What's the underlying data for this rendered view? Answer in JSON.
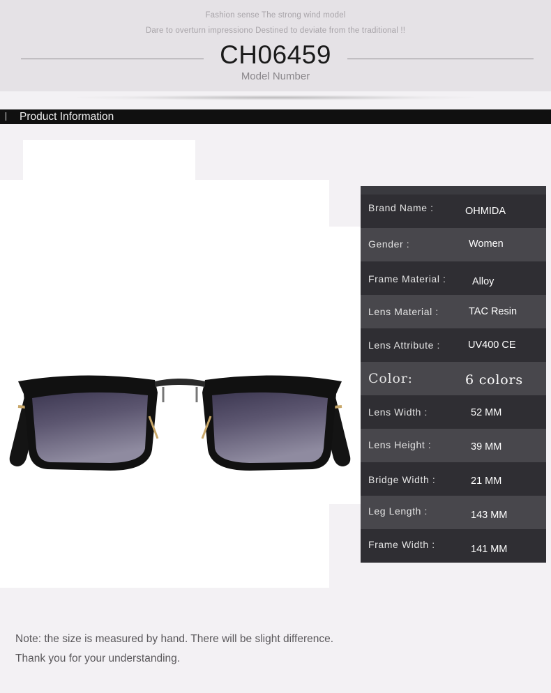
{
  "header": {
    "tagline_1": "Fashion sense The strong wind model",
    "tagline_2": "Dare to overturn impressiono Destined to deviate from the traditional !!",
    "model_number": "CH06459",
    "model_label": "Model Number"
  },
  "section": {
    "title": "Product Information"
  },
  "product_image": {
    "icon": "sunglasses-image",
    "lens_color": "#4b4560",
    "frame_color": "#111111"
  },
  "specs": [
    {
      "label": "Brand Name :",
      "value": "OHMIDA"
    },
    {
      "label": "Gender :",
      "value": "Women"
    },
    {
      "label": "Frame Material :",
      "value": "Alloy"
    },
    {
      "label": "Lens Material :",
      "value": "TAC Resin"
    },
    {
      "label": "Lens Attribute :",
      "value": "UV400 CE"
    },
    {
      "label": "Color:",
      "value": "6 colors"
    },
    {
      "label": "Lens Width :",
      "value": "52 MM"
    },
    {
      "label": "Lens Height :",
      "value": "39 MM"
    },
    {
      "label": "Bridge Width :",
      "value": "21 MM"
    },
    {
      "label": "Leg Length :",
      "value": "143 MM"
    },
    {
      "label": "Frame Width :",
      "value": "141 MM"
    }
  ],
  "note": {
    "line_1": "Note: the size is measured by hand. There will be slight difference.",
    "line_2": "Thank you for your understanding."
  }
}
